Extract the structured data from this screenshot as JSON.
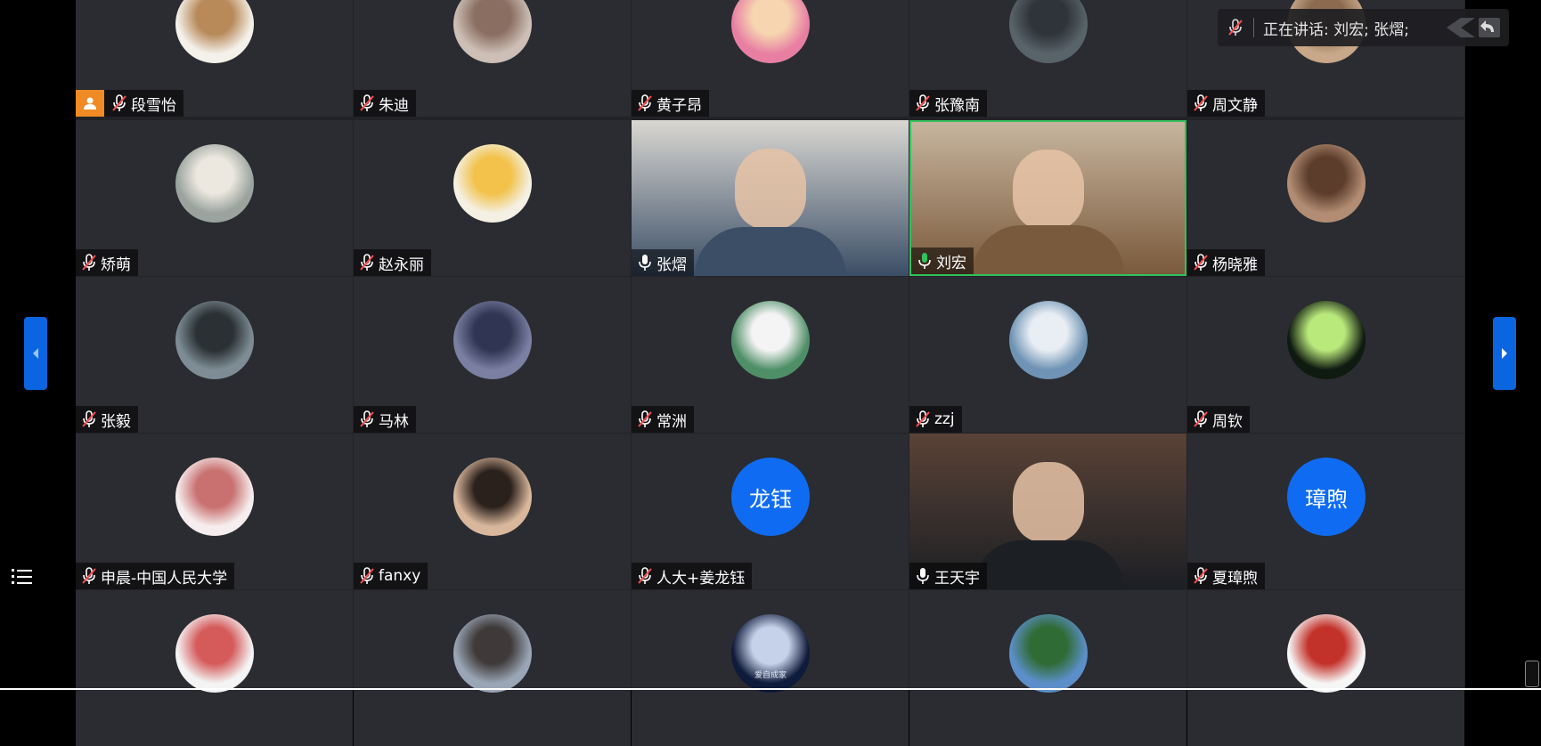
{
  "speaking_bar": {
    "text": "正在讲话: 刘宏; 张熠;"
  },
  "participants": [
    {
      "name": "段雪怡",
      "muted": true,
      "host": true,
      "avatar": "cartoon-girl",
      "bg": "#f4f1ea",
      "fg": "#b88a5a"
    },
    {
      "name": "朱迪",
      "muted": true,
      "avatar": "girl-with-rabbit",
      "bg": "#cdbfb6",
      "fg": "#8a6e62"
    },
    {
      "name": "黄子昂",
      "muted": true,
      "avatar": "peanuts-character",
      "bg": "#e87fa3",
      "fg": "#f6d5b0"
    },
    {
      "name": "张豫南",
      "muted": true,
      "avatar": "street-photo",
      "bg": "#59636a",
      "fg": "#2e3439"
    },
    {
      "name": "周文静",
      "muted": true,
      "avatar": "partial-photo",
      "bg": "#c8a889",
      "fg": "#8b6a4f"
    },
    {
      "name": "矫萌",
      "muted": true,
      "avatar": "plush-toy",
      "bg": "#9aa39e",
      "fg": "#ece7df"
    },
    {
      "name": "赵永丽",
      "muted": true,
      "avatar": "cartoon-cat",
      "bg": "#f4f0e3",
      "fg": "#f2c24a"
    },
    {
      "name": "张熠",
      "muted": false,
      "video": true,
      "avatar": "man-in-suit",
      "bg": "#d9d7d2",
      "fg": "#3b4e66"
    },
    {
      "name": "刘宏",
      "muted": false,
      "video": true,
      "speaking": true,
      "avatar": "woman-with-bookshelf",
      "bg": "#c7b59e",
      "fg": "#7a5a3c"
    },
    {
      "name": "杨晓雅",
      "muted": true,
      "avatar": "woman-portrait",
      "bg": "#b28d73",
      "fg": "#5c3d2c"
    },
    {
      "name": "张毅",
      "muted": true,
      "avatar": "runner-photo",
      "bg": "#7e8d95",
      "fg": "#2a3033"
    },
    {
      "name": "马林",
      "muted": true,
      "avatar": "lake-sunset",
      "bg": "#7b7fa2",
      "fg": "#2f3552"
    },
    {
      "name": "常洲",
      "muted": true,
      "avatar": "snoopy",
      "bg": "#4f8f68",
      "fg": "#f4f4f4"
    },
    {
      "name": "zzj",
      "muted": true,
      "avatar": "mascot-drawing",
      "bg": "#6f93b4",
      "fg": "#e8eef4"
    },
    {
      "name": "周钦",
      "muted": true,
      "avatar": "lotus-flower",
      "bg": "#0f1a10",
      "fg": "#b9e87b"
    },
    {
      "name": "申晨-中国人民大学",
      "muted": true,
      "avatar": "cartoon-couple",
      "bg": "#f6eeee",
      "fg": "#c97070"
    },
    {
      "name": "fanxy",
      "muted": true,
      "avatar": "girl-portrait",
      "bg": "#d9b79c",
      "fg": "#2b211c"
    },
    {
      "name": "人大+姜龙钰",
      "muted": true,
      "avatar_text": "龙钰"
    },
    {
      "name": "王天宇",
      "muted": false,
      "video": true,
      "avatar": "man-with-bookshelf",
      "bg": "#5a4236",
      "fg": "#1c1f24"
    },
    {
      "name": "夏璋煦",
      "muted": true,
      "avatar_text": "璋煦"
    },
    {
      "name": "",
      "muted": true,
      "avatar": "cartoon-cat-cap",
      "bg": "#f4f4f4",
      "fg": "#d55b5b"
    },
    {
      "name": "",
      "muted": true,
      "avatar": "girl-seaside",
      "bg": "#9aa6b6",
      "fg": "#3f3a39"
    },
    {
      "name": "",
      "muted": true,
      "avatar": "moon",
      "bg": "#0f1b3a",
      "fg": "#c6d2ea",
      "caption": "爱自成家"
    },
    {
      "name": "",
      "muted": true,
      "avatar": "park-trees",
      "bg": "#5c8fc9",
      "fg": "#2f6b34"
    },
    {
      "name": "",
      "muted": true,
      "avatar": "basketball-player",
      "bg": "#f6f6f6",
      "fg": "#c3322a"
    }
  ]
}
